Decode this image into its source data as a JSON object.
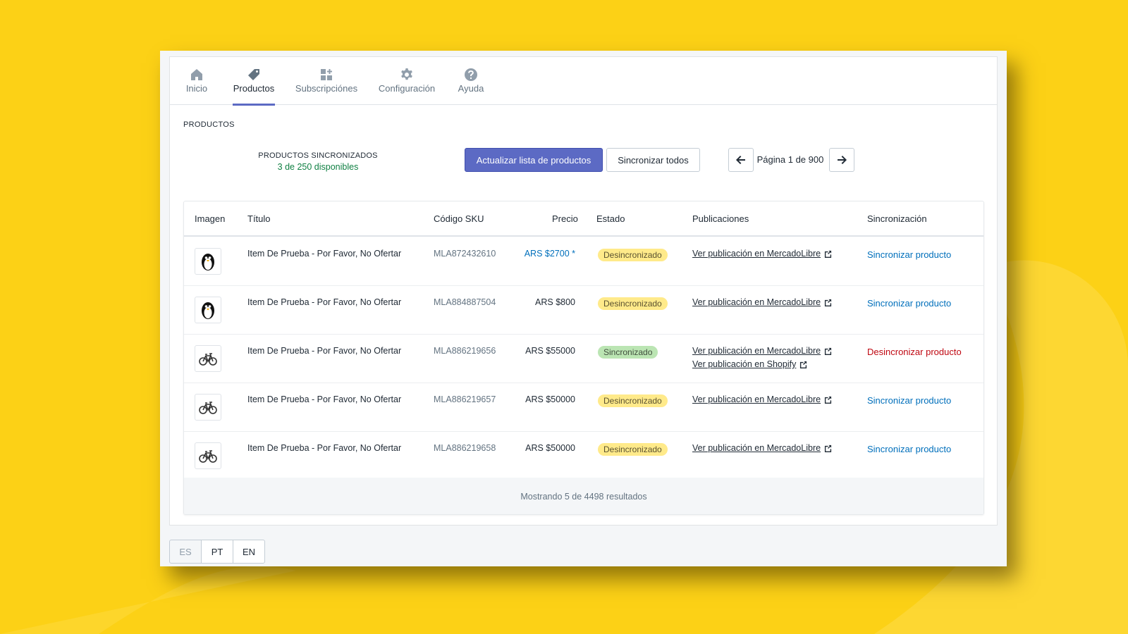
{
  "nav": {
    "items": [
      {
        "label": "Inicio",
        "icon": "home-icon"
      },
      {
        "label": "Productos",
        "icon": "tag-icon",
        "active": true
      },
      {
        "label": "Subscripciónes",
        "icon": "apps-icon"
      },
      {
        "label": "Configuración",
        "icon": "gear-icon"
      },
      {
        "label": "Ayuda",
        "icon": "help-icon"
      }
    ]
  },
  "section_title": "PRODUCTOS",
  "sync_summary": {
    "label": "PRODUCTOS SINCRONIZADOS",
    "count": "3 de 250 disponibles"
  },
  "toolbar": {
    "refresh_label": "Actualizar lista de productos",
    "sync_all_label": "Sincronizar todos"
  },
  "pagination": {
    "text": "Página 1 de 900",
    "prev_icon": "arrow-left-icon",
    "next_icon": "arrow-right-icon"
  },
  "table": {
    "headers": {
      "image": "Imagen",
      "title": "Título",
      "sku": "Código SKU",
      "price": "Precio",
      "status": "Estado",
      "publications": "Publicaciones",
      "sync": "Sincronización"
    },
    "rows": [
      {
        "image": "penguin",
        "title": "Item De Prueba - Por Favor, No Ofertar",
        "sku": "MLA872432610",
        "price": "ARS $2700 *",
        "status": "Desincronizado",
        "publications": [
          "Ver publicación en MercadoLibre"
        ],
        "action": "Sincronizar producto"
      },
      {
        "image": "penguin",
        "title": "Item De Prueba - Por Favor, No Ofertar",
        "sku": "MLA884887504",
        "price": "ARS $800",
        "status": "Desincronizado",
        "publications": [
          "Ver publicación en MercadoLibre"
        ],
        "action": "Sincronizar producto"
      },
      {
        "image": "bike",
        "title": "Item De Prueba - Por Favor, No Ofertar",
        "sku": "MLA886219656",
        "price": "ARS $55000",
        "status": "Sincronizado",
        "publications": [
          "Ver publicación en MercadoLibre",
          "Ver publicación en Shopify"
        ],
        "action": "Desincronizar producto"
      },
      {
        "image": "bike",
        "title": "Item De Prueba - Por Favor, No Ofertar",
        "sku": "MLA886219657",
        "price": "ARS $50000",
        "status": "Desincronizado",
        "publications": [
          "Ver publicación en MercadoLibre"
        ],
        "action": "Sincronizar producto"
      },
      {
        "image": "bike",
        "title": "Item De Prueba - Por Favor, No Ofertar",
        "sku": "MLA886219658",
        "price": "ARS $50000",
        "status": "Desincronizado",
        "publications": [
          "Ver publicación en MercadoLibre"
        ],
        "action": "Sincronizar producto"
      }
    ],
    "footer": "Mostrando 5 de 4498 resultados"
  },
  "languages": {
    "items": [
      "ES",
      "PT",
      "EN"
    ],
    "active": "ES"
  },
  "colors": {
    "background": "#fcd116",
    "accent": "#5c6ac4",
    "link": "#006fbb",
    "danger": "#bf0711",
    "badge_unsynced": "#ffea8a",
    "badge_synced": "#bbe5b3"
  }
}
